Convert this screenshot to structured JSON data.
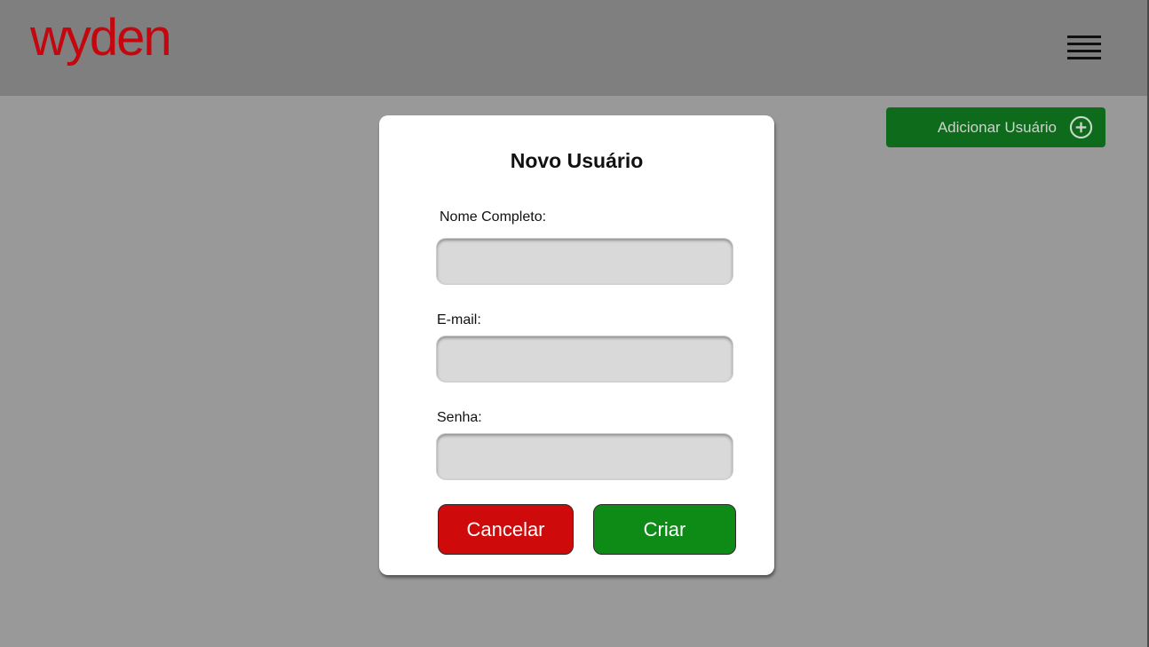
{
  "header": {
    "logo_text": "wyden",
    "menu_icon": "hamburger-menu-icon"
  },
  "actions": {
    "add_user_label": "Adicionar Usuário",
    "add_user_icon": "plus-circle-icon"
  },
  "modal": {
    "title": "Novo Usuário",
    "fields": [
      {
        "label": "Nome Completo:",
        "value": "",
        "placeholder": ""
      },
      {
        "label": "E-mail:",
        "value": "",
        "placeholder": ""
      },
      {
        "label": "Senha:",
        "value": "",
        "placeholder": ""
      }
    ],
    "cancel_label": "Cancelar",
    "create_label": "Criar"
  },
  "colors": {
    "brand_red": "#c4070f",
    "header_bg": "#7f7f7f",
    "overlay_bg": "#999999",
    "add_button_green": "#0e6b1c",
    "cancel_red": "#cf0a0a",
    "create_green": "#0e8a16",
    "input_bg": "#d9d9d9"
  }
}
